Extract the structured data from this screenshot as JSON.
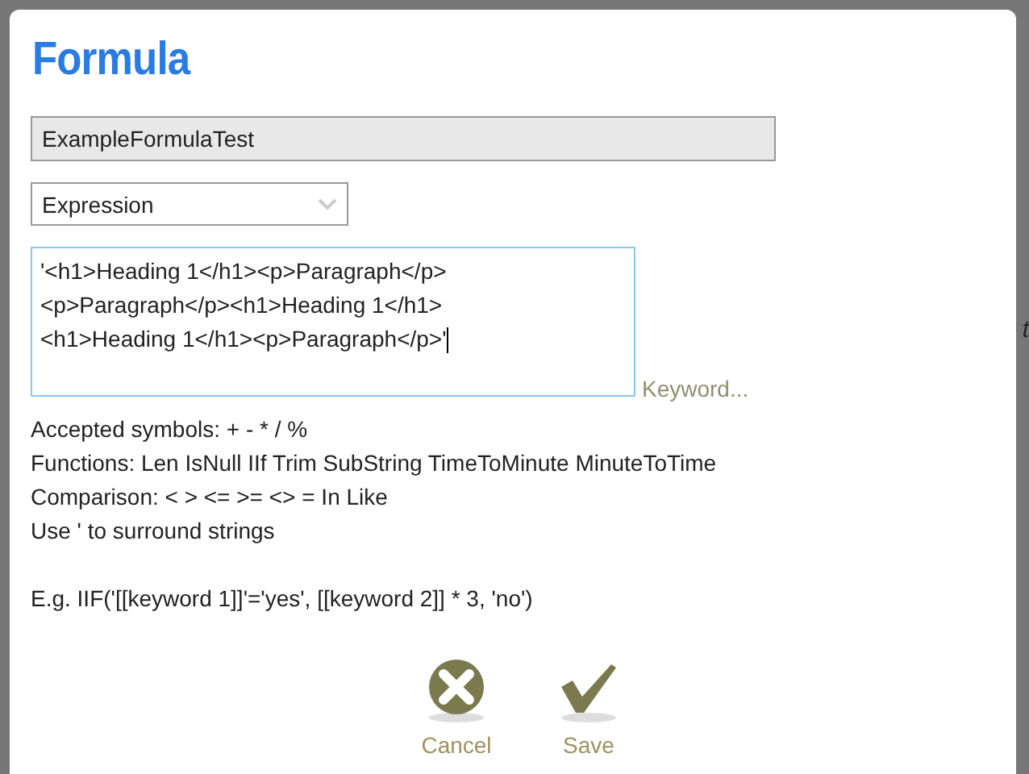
{
  "backdrop_text": "t",
  "dialog": {
    "title": "Formula",
    "name_field": {
      "value": "ExampleFormulaTest",
      "disabled": true
    },
    "type_select": {
      "value": "Expression"
    },
    "expression": {
      "lines": [
        "'<h1>Heading 1</h1><p>Paragraph</p>",
        "<p>Paragraph</p><h1>Heading 1</h1>",
        "<h1>Heading 1</h1><p>Paragraph</p>'"
      ]
    },
    "keyword_link": "Keyword...",
    "help": [
      "Accepted symbols: + - * / %",
      "Functions: Len IsNull IIf Trim SubString TimeToMinute MinuteToTime",
      "Comparison: < > <= >= <> = In Like",
      "Use ' to surround strings"
    ],
    "example": "E.g. IIF('[[keyword 1]]'='yes', [[keyword 2]] * 3, 'no')",
    "buttons": [
      {
        "kind": "cancel",
        "label": "Cancel"
      },
      {
        "kind": "save",
        "label": "Save"
      }
    ]
  }
}
